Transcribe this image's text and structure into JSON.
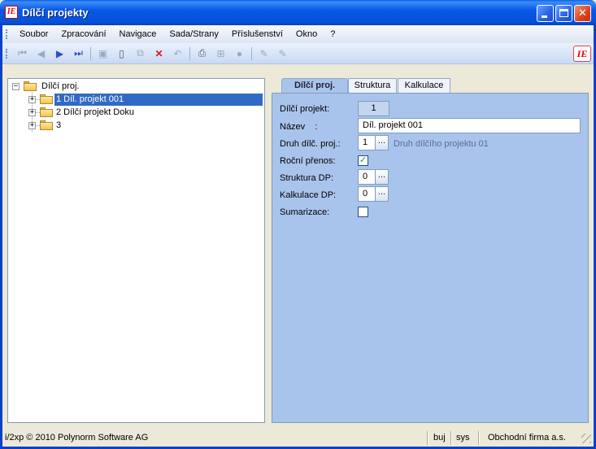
{
  "window": {
    "title": "Dílčí projekty",
    "app_icon": "ie-logo-icon"
  },
  "menu": [
    "Soubor",
    "Zpracování",
    "Navigace",
    "Sada/Strany",
    "Příslušenství",
    "Okno",
    "?"
  ],
  "toolbar_logo": "ie-logo-icon",
  "tree": {
    "root": "Dílčí proj.",
    "children": [
      "1 Díl. projekt 001",
      "2 Dílčí projekt Doku",
      "3"
    ],
    "selected_index": 0
  },
  "tabs": [
    "Dílčí proj.",
    "Struktura",
    "Kalkulace"
  ],
  "form": {
    "dilci_projekt": {
      "label": "Dílčí projekt:",
      "value": "1"
    },
    "nazev": {
      "label": "Název    :",
      "value": "Díl. projekt 001"
    },
    "druh": {
      "label": "Druh dílč. proj.:",
      "value": "1",
      "button": "...",
      "hint": "Druh dílčího projektu 01"
    },
    "rocni_prenos": {
      "label": "Roční přenos:",
      "checked": true,
      "mark": "✓"
    },
    "struktura_dp": {
      "label": "Struktura DP:",
      "value": "0",
      "button": "..."
    },
    "kalkulace_dp": {
      "label": "Kalkulace DP:",
      "value": "0",
      "button": "..."
    },
    "sumarizace": {
      "label": "Sumarizace:",
      "checked": false
    }
  },
  "status": {
    "copyright": "i/2xp © 2010 Polynorm Software AG",
    "user1": "buj",
    "user2": "sys",
    "company": "Obchodní firma a.s."
  }
}
